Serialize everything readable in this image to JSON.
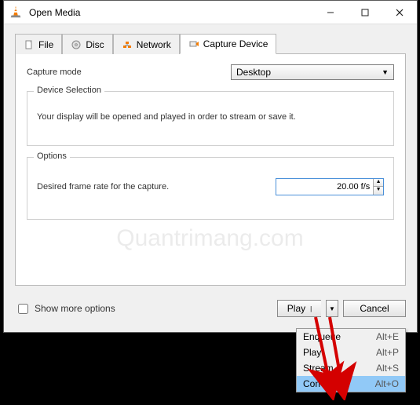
{
  "window": {
    "title": "Open Media"
  },
  "tabs": {
    "file": "File",
    "disc": "Disc",
    "network": "Network",
    "capture": "Capture Device"
  },
  "capture": {
    "mode_label": "Capture mode",
    "mode_value": "Desktop",
    "device_selection_title": "Device Selection",
    "device_selection_text": "Your display will be opened and played in order to stream or save it.",
    "options_title": "Options",
    "frame_rate_label": "Desired frame rate for the capture.",
    "frame_rate_value": "20.00 f/s"
  },
  "footer": {
    "show_more": "Show more options",
    "play": "Play",
    "cancel": "Cancel"
  },
  "menu": {
    "enqueue": {
      "label": "Enqueue",
      "shortcut": "Alt+E"
    },
    "play": {
      "label": "Play",
      "shortcut": "Alt+P"
    },
    "stream": {
      "label": "Stream",
      "shortcut": "Alt+S"
    },
    "convert": {
      "label": "Convert",
      "shortcut": "Alt+O"
    }
  },
  "watermark": "Quantrimang.com"
}
